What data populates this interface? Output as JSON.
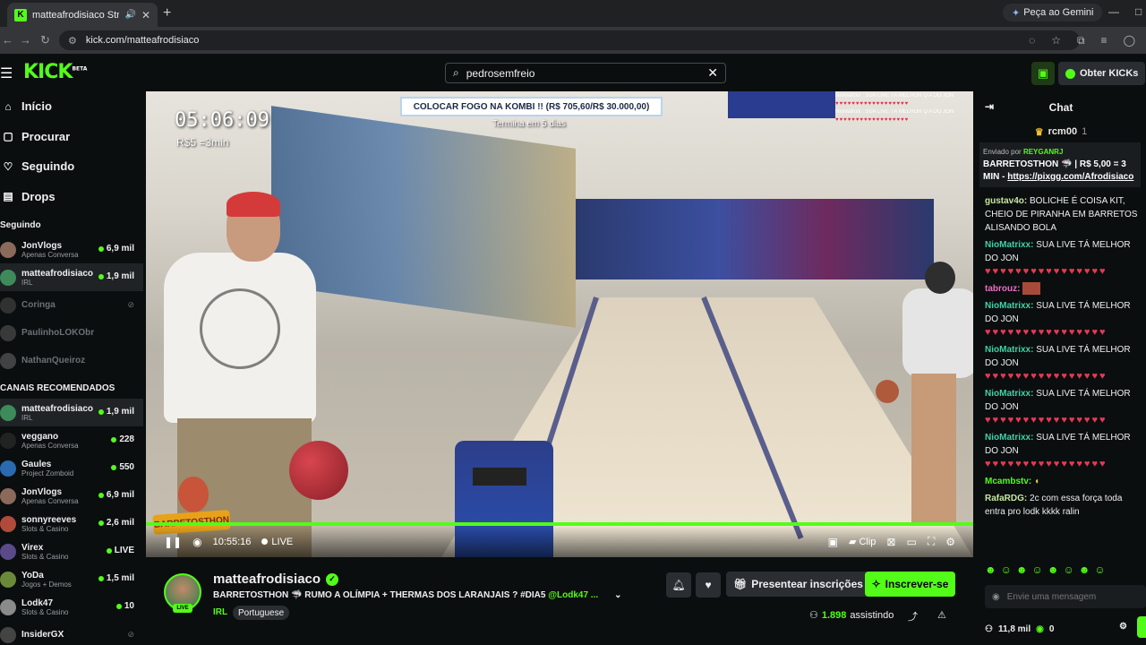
{
  "browser": {
    "tab_title": "matteafrodisiaco Stream - V",
    "url": "kick.com/matteafrodisiaco",
    "gemini_label": "Peça ao Gemini"
  },
  "header": {
    "logo": "KICK",
    "logo_badge": "BETA",
    "search_value": "pedrosemfreio",
    "obter_label": "Obter KICKs"
  },
  "sidebar": {
    "nav": [
      {
        "label": "Início"
      },
      {
        "label": "Procurar"
      },
      {
        "label": "Seguindo"
      },
      {
        "label": "Drops"
      }
    ],
    "following_title": "Seguindo",
    "following": [
      {
        "name": "JonVlogs",
        "sub": "Apenas Conversa",
        "count": "6,9 mil"
      },
      {
        "name": "matteafrodisiaco",
        "sub": "IRL",
        "count": "1,9 mil"
      },
      {
        "name": "Coringa"
      },
      {
        "name": "PaulinhoLOKObr"
      },
      {
        "name": "NathanQueiroz"
      }
    ],
    "recommended_title": "CANAIS RECOMENDADOS",
    "recommended": [
      {
        "name": "matteafrodisiaco",
        "sub": "IRL",
        "count": "1,9 mil"
      },
      {
        "name": "veggano",
        "sub": "Apenas Conversa",
        "count": "228"
      },
      {
        "name": "Gaules",
        "sub": "Project Zomboid",
        "count": "550"
      },
      {
        "name": "JonVlogs",
        "sub": "Apenas Conversa",
        "count": "6,9 mil"
      },
      {
        "name": "sonnyreeves",
        "sub": "Slots & Casino",
        "count": "2,6 mil"
      },
      {
        "name": "Virex",
        "sub": "Slots & Casino",
        "count": "LIVE"
      },
      {
        "name": "YoDa",
        "sub": "Jogos + Demos",
        "count": "1,5 mil"
      },
      {
        "name": "Lodk47",
        "sub": "Slots & Casino",
        "count": "10"
      },
      {
        "name": "InsiderGX",
        "sub": "",
        "count": ""
      }
    ]
  },
  "video": {
    "timer": "05:06:09",
    "rate": "R$5 =3min",
    "goal": "COLOCAR FOGO NA KOMBI !! (R$ 705,60/R$ 30.000,00)",
    "goal_sub": "Termina em 5 dias",
    "overlay_line1": "NioMatrixx : SUA LIVE TÁ MELHOR Q A DO JON",
    "overlay_line2": "NioMatrixx : SUA LIVE TÁ MELHOR Q A DO JON",
    "sticker_text": "BARRETOSTHON",
    "elapsed": "10:55:16",
    "live_label": "LIVE",
    "clip_label": "Clip",
    "progress": 1.0
  },
  "stream": {
    "name": "matteafrodisiaco",
    "title": "BARRETOSTHON 🦈 RUMO A OLÍMPIA + THERMAS DOS LARANJAIS ? #DIA5",
    "title_tag": "@Lodk47 ...",
    "category": "IRL",
    "language": "Portuguese",
    "gift_label": "Presentear inscrições",
    "subscribe_label": "Inscrever-se",
    "viewers": "1.898",
    "viewers_suffix": "assistindo",
    "live_badge": "LIVE"
  },
  "chat": {
    "title": "Chat",
    "pinned_user": "rcm00",
    "pinned_num": "1",
    "pinned_by_label": "Enviado por",
    "pinned_by": "REYGANRJ",
    "pinned_text": "BARRETOSTHON 🦈 | R$ 5,00 = 3 MIN -",
    "pinned_link": "https://pixgg.com/Afrodisiaco",
    "messages": [
      {
        "user": "gustav4o:",
        "color": "#c7e8a0",
        "text": "BOLICHE É COISA KIT, CHEIO DE PIRANHA EM BARRETOS ALISANDO BOLA",
        "emotes": ""
      },
      {
        "user": "NioMatrixx:",
        "color": "#3ed3a6",
        "text": "SUA LIVE TÁ MELHOR DO JON",
        "emotes": "♥♥♥♥♥♥♥♥♥♥♥♥♥♥♥♥"
      },
      {
        "user": "tabrouz:",
        "color": "#e86fc6",
        "text": "",
        "emotes": ""
      },
      {
        "user": "NioMatrixx:",
        "color": "#3ed3a6",
        "text": "SUA LIVE TÁ MELHOR DO JON",
        "emotes": "♥♥♥♥♥♥♥♥♥♥♥♥♥♥♥♥"
      },
      {
        "user": "NioMatrixx:",
        "color": "#3ed3a6",
        "text": "SUA LIVE TÁ MELHOR DO JON",
        "emotes": "♥♥♥♥♥♥♥♥♥♥♥♥♥♥♥♥"
      },
      {
        "user": "NioMatrixx:",
        "color": "#3ed3a6",
        "text": "SUA LIVE TÁ MELHOR DO JON",
        "emotes": "♥♥♥♥♥♥♥♥♥♥♥♥♥♥♥♥"
      },
      {
        "user": "NioMatrixx:",
        "color": "#3ed3a6",
        "text": "SUA LIVE TÁ MELHOR DO JON",
        "emotes": "♥♥♥♥♥♥♥♥♥♥♥♥♥♥♥♥"
      },
      {
        "user": "Mcambstv:",
        "color": "#53fc18",
        "text": "",
        "emotes": ""
      },
      {
        "user": "RafaRDG:",
        "color": "#c7e8a0",
        "text": "2c com essa força toda entra pro lodk kkkk ralin",
        "emotes": ""
      }
    ],
    "input_placeholder": "Envie uma mensagem",
    "followers": "11,8 mil",
    "kicks": "0"
  },
  "colors": {
    "accent": "#53fc18",
    "background": "#0b0e0f"
  }
}
